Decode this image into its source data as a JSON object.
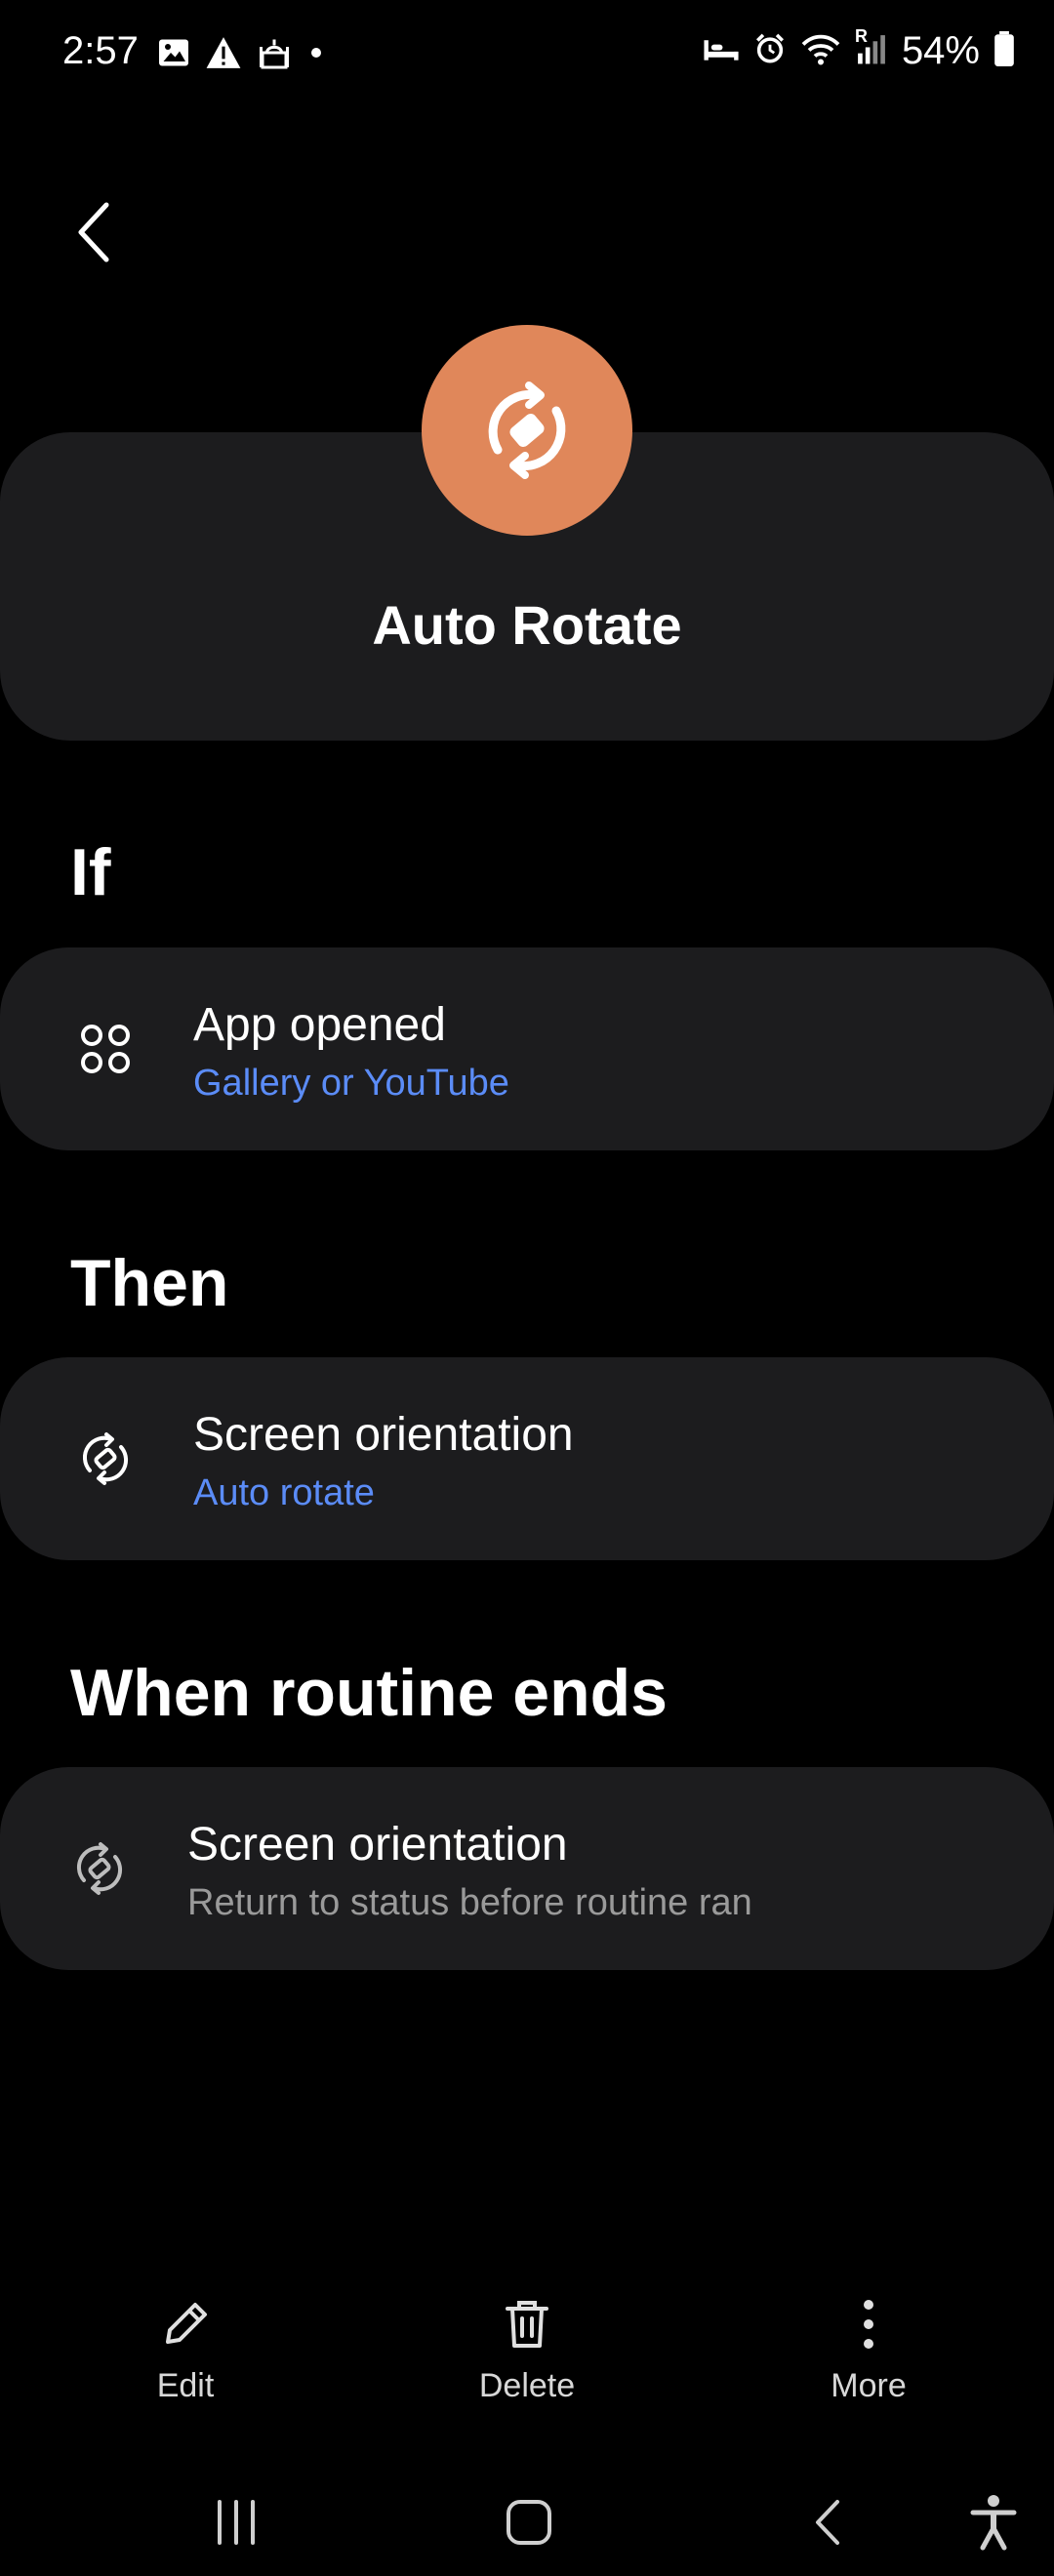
{
  "status_bar": {
    "time": "2:57",
    "battery": "54%",
    "signal_label": "R"
  },
  "header": {
    "title": "Auto Rotate",
    "icon": "rotate-icon",
    "icon_color": "#e0875a"
  },
  "sections": {
    "if": {
      "heading": "If",
      "item": {
        "title": "App opened",
        "subtitle": "Gallery or YouTube",
        "icon": "apps-icon"
      }
    },
    "then": {
      "heading": "Then",
      "item": {
        "title": "Screen orientation",
        "subtitle": "Auto rotate",
        "icon": "rotate-icon"
      }
    },
    "ends": {
      "heading": "When routine ends",
      "item": {
        "title": "Screen orientation",
        "subtitle": "Return to status before routine ran",
        "icon": "rotate-icon"
      }
    }
  },
  "toolbar": {
    "edit_label": "Edit",
    "delete_label": "Delete",
    "more_label": "More"
  },
  "colors": {
    "accent_link": "#5b8cf7",
    "muted_text": "#9a9a9a",
    "card_bg": "#1c1c1e"
  }
}
